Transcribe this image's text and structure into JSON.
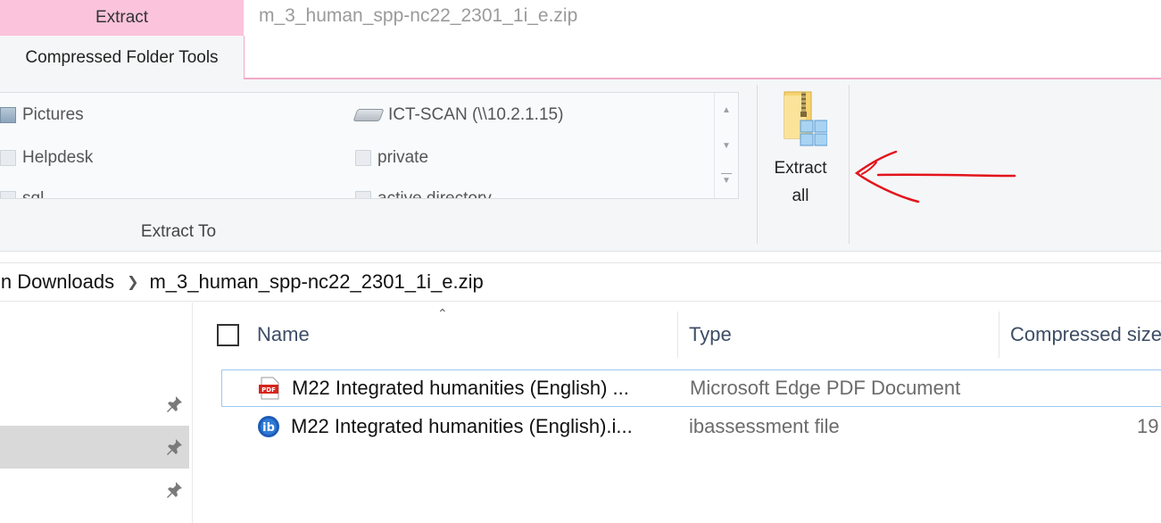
{
  "tabs": {
    "context_tab": "Extract",
    "active_tab": "Compressed Folder Tools"
  },
  "window": {
    "title": "m_3_human_spp-nc22_2301_1i_e.zip"
  },
  "ribbon": {
    "destinations": [
      {
        "label": "Pictures",
        "icon": "pictures-icon"
      },
      {
        "label": "ICT-SCAN (\\\\10.2.1.15)",
        "icon": "network-drive-icon"
      },
      {
        "label": "Helpdesk",
        "icon": "folder-icon"
      },
      {
        "label": "private",
        "icon": "folder-icon"
      },
      {
        "label": "sql",
        "icon": "folder-icon"
      },
      {
        "label": "active directory",
        "icon": "folder-icon"
      }
    ],
    "extract_to_label": "Extract To",
    "extract_all_line1": "Extract",
    "extract_all_line2": "all",
    "annotation_color": "#e3141b"
  },
  "address_bar": {
    "crumbs": [
      "in Downloads",
      "m_3_human_spp-nc22_2301_1i_e.zip"
    ]
  },
  "columns": {
    "name": "Name",
    "type": "Type",
    "compressed_size": "Compressed size"
  },
  "files": [
    {
      "name": "M22 Integrated humanities (English) ...",
      "type": "Microsoft Edge PDF Document",
      "size": "",
      "icon": "pdf-icon"
    },
    {
      "name": "M22 Integrated humanities (English).i...",
      "type": "ibassessment file",
      "size": "19",
      "icon": "ib-icon"
    }
  ]
}
